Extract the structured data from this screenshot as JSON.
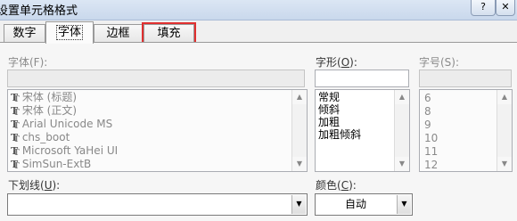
{
  "window": {
    "title": "设置单元格格式",
    "help_label": "?",
    "close_label": "✕"
  },
  "tabs": [
    {
      "label": "数字",
      "active": false,
      "highlighted": false
    },
    {
      "label": "字体",
      "active": true,
      "highlighted": false
    },
    {
      "label": "边框",
      "active": false,
      "highlighted": false
    },
    {
      "label": "填充",
      "active": false,
      "highlighted": true
    }
  ],
  "font": {
    "label": "字体(F):",
    "value": "",
    "items": [
      {
        "icon": "truetype-font-icon",
        "name": "宋体 (标题)"
      },
      {
        "icon": "truetype-font-icon",
        "name": "宋体 (正文)"
      },
      {
        "icon": "truetype-font-icon",
        "name": "Arial Unicode MS"
      },
      {
        "icon": "truetype-font-icon",
        "name": "chs_boot"
      },
      {
        "icon": "truetype-font-icon",
        "name": "Microsoft YaHei UI"
      },
      {
        "icon": "truetype-font-icon",
        "name": "SimSun-ExtB"
      }
    ]
  },
  "style": {
    "label_prefix": "字形(",
    "label_key": "O",
    "label_suffix": "):",
    "value": "",
    "items": [
      "常规",
      "倾斜",
      "加粗",
      "加粗倾斜"
    ]
  },
  "size": {
    "label": "字号(S):",
    "value": "",
    "items": [
      "6",
      "8",
      "9",
      "10",
      "11",
      "12"
    ]
  },
  "underline": {
    "label_prefix": "下划线(",
    "label_key": "U",
    "label_suffix": "):",
    "value": ""
  },
  "color": {
    "label_prefix": "颜色(",
    "label_key": "C",
    "label_suffix": "):",
    "value": "自动"
  },
  "scroll": {
    "up": "▲",
    "down": "▼"
  },
  "dropdown_arrow": "▼",
  "colors": {
    "highlight": "#e03030"
  }
}
